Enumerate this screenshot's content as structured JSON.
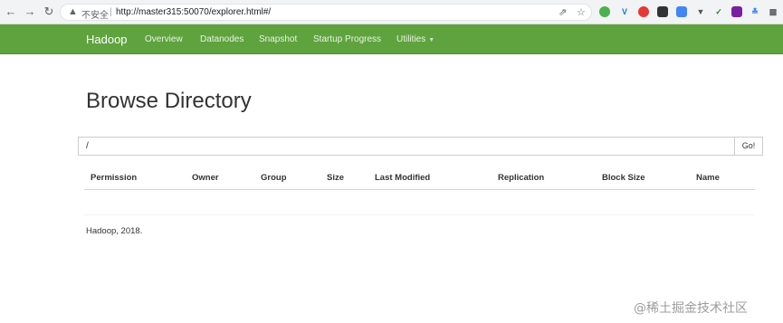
{
  "browser": {
    "insecure_label": "不安全",
    "separator": "|",
    "url": "http://master315:50070/explorer.html#/"
  },
  "navbar": {
    "brand": "Hadoop",
    "items": [
      {
        "label": "Overview"
      },
      {
        "label": "Datanodes"
      },
      {
        "label": "Snapshot"
      },
      {
        "label": "Startup Progress"
      },
      {
        "label": "Utilities"
      }
    ]
  },
  "page": {
    "title": "Browse Directory",
    "path_value": "/",
    "go_label": "Go!"
  },
  "table": {
    "columns": [
      "Permission",
      "Owner",
      "Group",
      "Size",
      "Last Modified",
      "Replication",
      "Block Size",
      "Name"
    ],
    "rows": []
  },
  "footer": {
    "text": "Hadoop, 2018."
  },
  "watermark": {
    "text": "@稀土掘金技术社区"
  },
  "colors": {
    "navbar": "#5fa33e",
    "chrome": "#f1f3f4"
  },
  "icons": {
    "back": "arrow-left-icon",
    "forward": "arrow-right-icon",
    "reload": "reload-icon",
    "warning": "warning-triangle-icon",
    "share": "share-icon",
    "star": "star-icon",
    "caret": "caret-down-icon"
  }
}
